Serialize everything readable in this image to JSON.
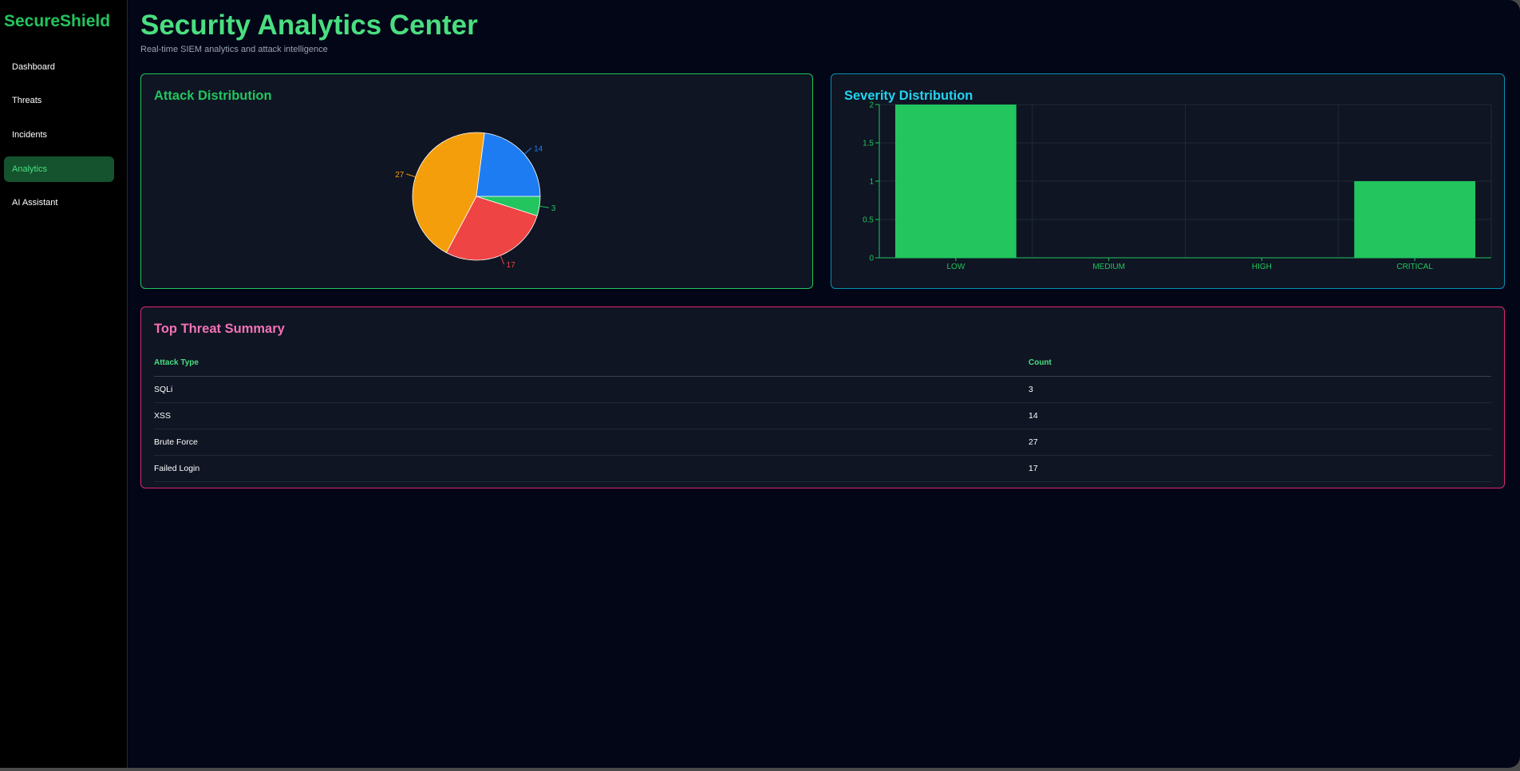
{
  "sidebar": {
    "brand": "SecureShield",
    "items": [
      {
        "label": "Dashboard"
      },
      {
        "label": "Threats"
      },
      {
        "label": "Incidents"
      },
      {
        "label": "Analytics"
      },
      {
        "label": "AI Assistant"
      }
    ],
    "active": "Analytics"
  },
  "header": {
    "title": "Security Analytics Center",
    "subtitle": "Real-time SIEM analytics and attack intelligence"
  },
  "attack_card": {
    "title": "Attack Distribution"
  },
  "severity_card": {
    "title": "Severity Distribution"
  },
  "table_card": {
    "title": "Top Threat Summary",
    "headers": [
      "Attack Type",
      "Count"
    ],
    "rows": [
      [
        "SQLi",
        "3"
      ],
      [
        "XSS",
        "14"
      ],
      [
        "Brute Force",
        "27"
      ],
      [
        "Failed Login",
        "17"
      ]
    ]
  },
  "colors": {
    "accent_green": "#22c55e",
    "accent_cyan": "#22d3ee",
    "accent_pink": "#f472b6"
  },
  "chart_data": [
    {
      "type": "pie",
      "title": "Attack Distribution",
      "labels": [
        "SQLi",
        "Failed Login",
        "Brute Force",
        "XSS"
      ],
      "values": [
        3,
        17,
        27,
        14
      ],
      "colors": [
        "#22c55e",
        "#ef4444",
        "#f59e0b",
        "#1d7cf2"
      ],
      "data_labels": [
        "3",
        "17",
        "27",
        "14"
      ]
    },
    {
      "type": "bar",
      "title": "Severity Distribution",
      "categories": [
        "LOW",
        "MEDIUM",
        "HIGH",
        "CRITICAL"
      ],
      "values": [
        2,
        0,
        0,
        1
      ],
      "ylim": [
        0,
        2
      ],
      "yticks": [
        "0",
        "0.5",
        "1",
        "1.5",
        "2"
      ],
      "grid": true,
      "color": "#22c55e"
    }
  ]
}
